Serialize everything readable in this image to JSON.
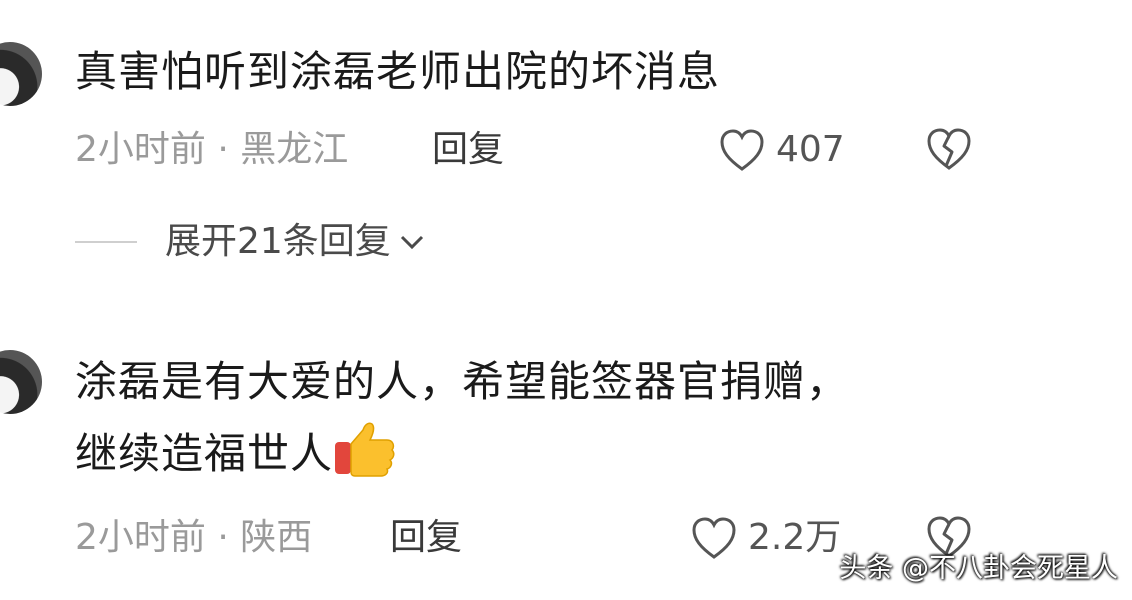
{
  "comments": [
    {
      "text": "真害怕听到涂磊老师出院的坏消息",
      "meta": "2小时前 · 黑龙江",
      "reply_label": "回复",
      "likes": "407",
      "expand_label": "展开21条回复"
    },
    {
      "text_line1": "涂磊是有大爱的人，希望能签器官捐赠，",
      "text_line2": "继续造福世人",
      "emoji": "thumbs-up",
      "meta": "2小时前 · 陕西",
      "reply_label": "回复",
      "likes": "2.2万"
    }
  ],
  "watermark": "头条 @不八卦会死星人",
  "colors": {
    "text": "#1a1a1a",
    "meta": "#9a9a9a",
    "icon": "#555555",
    "background": "#ffffff"
  }
}
